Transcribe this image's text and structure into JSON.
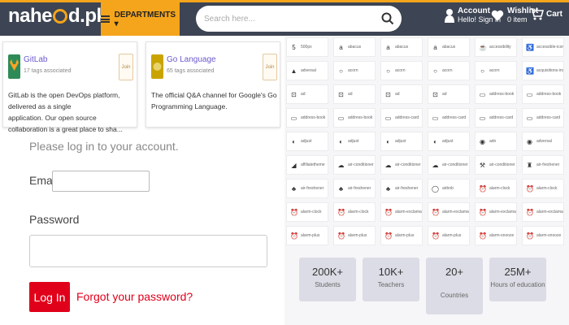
{
  "header": {
    "logo_text_before": "nahe",
    "logo_text_after": "d.pk",
    "departments_label": "DEPARTMENTS ▾",
    "search_placeholder": "Search here...",
    "account_title": "Account",
    "account_sub": "Hello! Sign in",
    "wishlist_title": "Wishlist",
    "wishlist_sub": "0 item",
    "cart_label": "Cart",
    "colors": {
      "bar": "#3d4453",
      "accent": "#f4a51c"
    }
  },
  "cards": [
    {
      "title": "GitLab",
      "tags": "17 tags associated",
      "join": "Join",
      "desc_line1": "GitLab is the open DevOps platform, delivered as a single",
      "desc_line2": "application. Our open source collaboration is a great place to sha..."
    },
    {
      "title": "Go Language",
      "tags": "65 tags associated",
      "join": "Join",
      "desc_line1": "The official Q&A channel for Google's Go Programming Language.",
      "desc_line2": ""
    }
  ],
  "login": {
    "prompt": "Please log in to your account.",
    "email_label": "Email",
    "password_label": "Password",
    "login_button": "Log In",
    "forgot_link": "Forgot your password?"
  },
  "icons": [
    {
      "glyph": "5",
      "label": "500px",
      "icon": "500px-icon"
    },
    {
      "glyph": "a",
      "label": "abacus",
      "icon": "abacus-icon"
    },
    {
      "glyph": "a",
      "label": "abacus",
      "icon": "abacus-icon"
    },
    {
      "glyph": "a",
      "label": "abacus",
      "icon": "abacus-icon"
    },
    {
      "glyph": "☕",
      "label": "accessibility",
      "icon": "accessibility-icon"
    },
    {
      "glyph": "♿",
      "label": "accessible-icon",
      "icon": "wheelchair-icon"
    },
    {
      "glyph": "▲",
      "label": "adversal",
      "icon": "adversal-icon"
    },
    {
      "glyph": "○",
      "label": "acorn",
      "icon": "acorn-icon"
    },
    {
      "glyph": "○",
      "label": "acorn",
      "icon": "acorn-icon"
    },
    {
      "glyph": "○",
      "label": "acorn",
      "icon": "acorn-icon"
    },
    {
      "glyph": "○",
      "label": "acorn",
      "icon": "acorn-icon"
    },
    {
      "glyph": "♿",
      "label": "acquisitions-incorporated",
      "icon": "person-icon"
    },
    {
      "glyph": "⊡",
      "label": "ad",
      "icon": "ad-icon"
    },
    {
      "glyph": "⊡",
      "label": "ad",
      "icon": "ad-icon"
    },
    {
      "glyph": "⊡",
      "label": "ad",
      "icon": "ad-icon"
    },
    {
      "glyph": "⊡",
      "label": "ad",
      "icon": "ad-icon"
    },
    {
      "glyph": "▭",
      "label": "address-book",
      "icon": "address-book-icon"
    },
    {
      "glyph": "▭",
      "label": "address-book",
      "icon": "address-book-icon"
    },
    {
      "glyph": "▭",
      "label": "address-book",
      "icon": "address-book-icon"
    },
    {
      "glyph": "▭",
      "label": "address-book",
      "icon": "address-book-icon"
    },
    {
      "glyph": "▭",
      "label": "address-card",
      "icon": "address-card-icon"
    },
    {
      "glyph": "▭",
      "label": "address-card",
      "icon": "address-card-icon"
    },
    {
      "glyph": "▭",
      "label": "address-card",
      "icon": "address-card-icon"
    },
    {
      "glyph": "▭",
      "label": "address-card",
      "icon": "address-card-icon"
    },
    {
      "glyph": "◐",
      "label": "adjust",
      "icon": "adjust-icon"
    },
    {
      "glyph": "◐",
      "label": "adjust",
      "icon": "adjust-icon"
    },
    {
      "glyph": "◐",
      "label": "adjust",
      "icon": "adjust-icon"
    },
    {
      "glyph": "◐",
      "label": "adjust",
      "icon": "adjust-icon"
    },
    {
      "glyph": "◉",
      "label": "adn",
      "icon": "adn-icon"
    },
    {
      "glyph": "◉",
      "label": "adversal",
      "icon": "adversal-icon"
    },
    {
      "glyph": "◢",
      "label": "affiliatetheme",
      "icon": "affiliatetheme-icon"
    },
    {
      "glyph": "☁",
      "label": "air-conditioner",
      "icon": "air-conditioner-icon"
    },
    {
      "glyph": "☁",
      "label": "air-conditioner",
      "icon": "air-conditioner-icon"
    },
    {
      "glyph": "☁",
      "label": "air-conditioner",
      "icon": "air-conditioner-icon"
    },
    {
      "glyph": "⚒",
      "label": "air-conditioner",
      "icon": "air-conditioner-icon"
    },
    {
      "glyph": "♜",
      "label": "air-freshener",
      "icon": "air-freshener-icon"
    },
    {
      "glyph": "♣",
      "label": "air-freshener",
      "icon": "air-freshener-icon"
    },
    {
      "glyph": "♣",
      "label": "air-freshener",
      "icon": "air-freshener-icon"
    },
    {
      "glyph": "♣",
      "label": "air-freshener",
      "icon": "air-freshener-icon"
    },
    {
      "glyph": "◯",
      "label": "airbnb",
      "icon": "airbnb-icon"
    },
    {
      "glyph": "⏰",
      "label": "alarm-clock",
      "icon": "alarm-clock-icon"
    },
    {
      "glyph": "⏰",
      "label": "alarm-clock",
      "icon": "alarm-clock-icon"
    },
    {
      "glyph": "⏰",
      "label": "alarm-clock",
      "icon": "alarm-clock-icon"
    },
    {
      "glyph": "⏰",
      "label": "alarm-clock",
      "icon": "alarm-clock-icon"
    },
    {
      "glyph": "⏰",
      "label": "alarm-exclamation",
      "icon": "alarm-exclamation-icon"
    },
    {
      "glyph": "⏰",
      "label": "alarm-exclamation",
      "icon": "alarm-exclamation-icon"
    },
    {
      "glyph": "⏰",
      "label": "alarm-exclamation",
      "icon": "alarm-exclamation-icon"
    },
    {
      "glyph": "⏰",
      "label": "alarm-exclamation",
      "icon": "alarm-exclamation-icon"
    },
    {
      "glyph": "⏰",
      "label": "alarm-plus",
      "icon": "alarm-plus-icon"
    },
    {
      "glyph": "⏰",
      "label": "alarm-plus",
      "icon": "alarm-plus-icon"
    },
    {
      "glyph": "⏰",
      "label": "alarm-plus",
      "icon": "alarm-plus-icon"
    },
    {
      "glyph": "⏰",
      "label": "alarm-plus",
      "icon": "alarm-plus-icon"
    },
    {
      "glyph": "⏰",
      "label": "alarm-snooze",
      "icon": "alarm-snooze-icon"
    },
    {
      "glyph": "⏰",
      "label": "alarm-snooze",
      "icon": "alarm-snooze-icon"
    }
  ],
  "stats": [
    {
      "num": "200K+",
      "label": "Students"
    },
    {
      "num": "10K+",
      "label": "Teachers"
    },
    {
      "num": "20+",
      "label": "Countries"
    },
    {
      "num": "25M+",
      "label": "Hours of education"
    }
  ]
}
